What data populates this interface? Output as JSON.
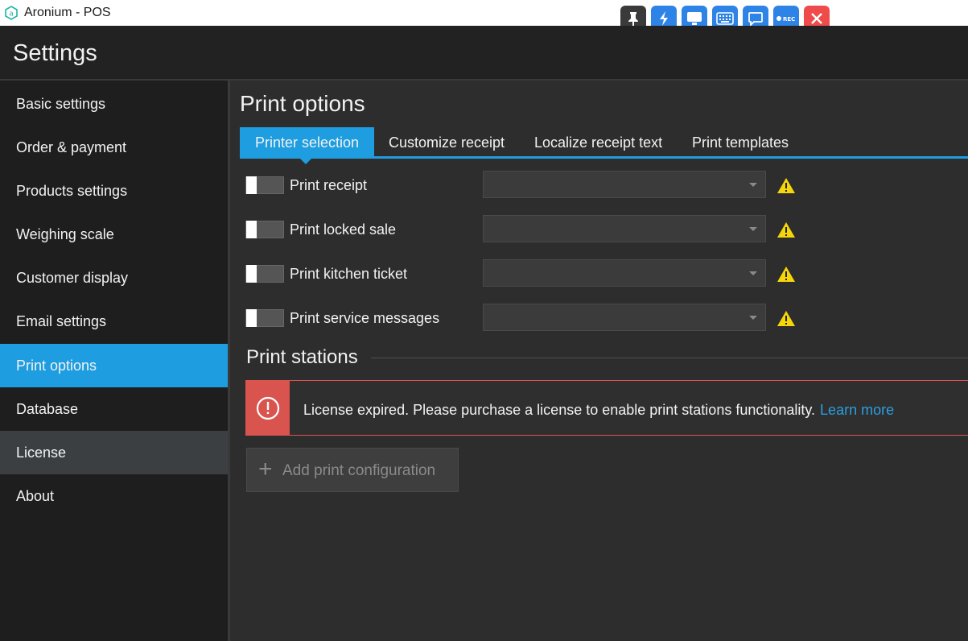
{
  "window": {
    "title": "Aronium - POS"
  },
  "remote_toolbar": {
    "buttons": [
      "pin-icon",
      "bolt-icon",
      "monitor-icon",
      "keyboard-icon",
      "chat-icon",
      "rec-icon",
      "close-icon"
    ],
    "rec_label": "REC"
  },
  "header": {
    "title": "Settings"
  },
  "sidebar": {
    "items": [
      {
        "label": "Basic settings"
      },
      {
        "label": "Order & payment"
      },
      {
        "label": "Products settings"
      },
      {
        "label": "Weighing scale"
      },
      {
        "label": "Customer display"
      },
      {
        "label": "Email settings"
      },
      {
        "label": "Print options",
        "state": "active"
      },
      {
        "label": "Database"
      },
      {
        "label": "License",
        "state": "hover"
      },
      {
        "label": "About"
      }
    ]
  },
  "main": {
    "title": "Print options",
    "tabs": [
      {
        "label": "Printer selection",
        "active": true
      },
      {
        "label": "Customize receipt"
      },
      {
        "label": "Localize receipt text"
      },
      {
        "label": "Print templates"
      }
    ],
    "print_options": [
      {
        "label": "Print receipt",
        "enabled": false,
        "printer": ""
      },
      {
        "label": "Print locked sale",
        "enabled": false,
        "printer": ""
      },
      {
        "label": "Print kitchen ticket",
        "enabled": false,
        "printer": ""
      },
      {
        "label": "Print service messages",
        "enabled": false,
        "printer": ""
      }
    ],
    "print_stations": {
      "title": "Print stations",
      "alert": {
        "message": "License expired. Please purchase a license to enable print stations functionality.",
        "link": "Learn more"
      },
      "add_button": "Add print configuration"
    }
  },
  "colors": {
    "accent": "#1e9de0",
    "danger": "#d9534f",
    "warning": "#f5d60a",
    "background": "#2d2d2d",
    "sidebar": "#1e1e1e"
  }
}
